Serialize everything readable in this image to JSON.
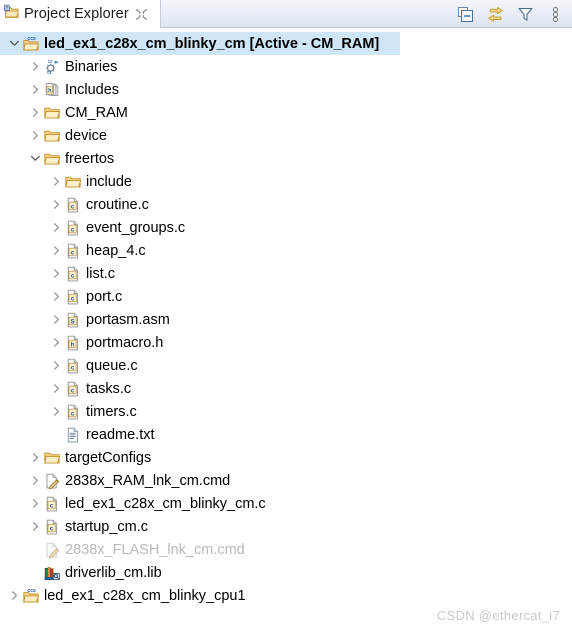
{
  "view": {
    "tab_title": "Project Explorer",
    "tab_icon": "project-explorer-icon",
    "close_icon": "tab-close-icon",
    "toolbar": [
      {
        "name": "collapse-all-button",
        "tooltip": "Collapse All"
      },
      {
        "name": "link-with-editor-button",
        "tooltip": "Link with Editor"
      },
      {
        "name": "filters-button",
        "tooltip": "Filters"
      },
      {
        "name": "view-menu-button",
        "tooltip": "View Menu"
      }
    ]
  },
  "colors": {
    "selection": "#cfe6f7",
    "folder": "#ddb978",
    "text": "#000000",
    "dimmed_text": "#b9b9b9",
    "watermark": "#c9c9c9",
    "arrow": "#8c8c8c"
  },
  "tree": [
    {
      "label": "led_ex1_c28x_cm_blinky_cm  [Active - CM_RAM]",
      "depth": 0,
      "icon": "ccs-project-icon",
      "arrow": "expanded",
      "selected": true,
      "bold": true
    },
    {
      "label": "Binaries",
      "depth": 1,
      "icon": "binaries-icon",
      "arrow": "collapsed",
      "selected": false
    },
    {
      "label": "Includes",
      "depth": 1,
      "icon": "includes-icon",
      "arrow": "collapsed",
      "selected": false
    },
    {
      "label": "CM_RAM",
      "depth": 1,
      "icon": "folder-icon",
      "arrow": "collapsed",
      "selected": false
    },
    {
      "label": "device",
      "depth": 1,
      "icon": "folder-icon",
      "arrow": "collapsed",
      "selected": false
    },
    {
      "label": "freertos",
      "depth": 1,
      "icon": "folder-icon",
      "arrow": "expanded",
      "selected": false
    },
    {
      "label": "include",
      "depth": 2,
      "icon": "folder-icon",
      "arrow": "collapsed",
      "selected": false
    },
    {
      "label": "croutine.c",
      "depth": 2,
      "icon": "c-file-icon",
      "arrow": "collapsed",
      "selected": false
    },
    {
      "label": "event_groups.c",
      "depth": 2,
      "icon": "c-file-icon",
      "arrow": "collapsed",
      "selected": false
    },
    {
      "label": "heap_4.c",
      "depth": 2,
      "icon": "c-file-icon",
      "arrow": "collapsed",
      "selected": false
    },
    {
      "label": "list.c",
      "depth": 2,
      "icon": "c-file-icon",
      "arrow": "collapsed",
      "selected": false
    },
    {
      "label": "port.c",
      "depth": 2,
      "icon": "c-file-icon",
      "arrow": "collapsed",
      "selected": false
    },
    {
      "label": "portasm.asm",
      "depth": 2,
      "icon": "asm-file-icon",
      "arrow": "collapsed",
      "selected": false
    },
    {
      "label": "portmacro.h",
      "depth": 2,
      "icon": "h-file-icon",
      "arrow": "collapsed",
      "selected": false
    },
    {
      "label": "queue.c",
      "depth": 2,
      "icon": "c-file-icon",
      "arrow": "collapsed",
      "selected": false
    },
    {
      "label": "tasks.c",
      "depth": 2,
      "icon": "c-file-icon",
      "arrow": "collapsed",
      "selected": false
    },
    {
      "label": "timers.c",
      "depth": 2,
      "icon": "c-file-icon",
      "arrow": "collapsed",
      "selected": false
    },
    {
      "label": "readme.txt",
      "depth": 2,
      "icon": "text-file-icon",
      "arrow": "none",
      "selected": false
    },
    {
      "label": "targetConfigs",
      "depth": 1,
      "icon": "folder-icon",
      "arrow": "collapsed",
      "selected": false
    },
    {
      "label": "2838x_RAM_lnk_cm.cmd",
      "depth": 1,
      "icon": "cmd-file-icon",
      "arrow": "collapsed",
      "selected": false
    },
    {
      "label": "led_ex1_c28x_cm_blinky_cm.c",
      "depth": 1,
      "icon": "c-file-icon",
      "arrow": "collapsed",
      "selected": false
    },
    {
      "label": "startup_cm.c",
      "depth": 1,
      "icon": "c-file-icon",
      "arrow": "collapsed",
      "selected": false
    },
    {
      "label": "2838x_FLASH_lnk_cm.cmd",
      "depth": 1,
      "icon": "cmd-file-excluded-icon",
      "arrow": "none",
      "selected": false,
      "dimmed": true
    },
    {
      "label": "driverlib_cm.lib",
      "depth": 1,
      "icon": "library-icon",
      "arrow": "none",
      "selected": false
    },
    {
      "label": "led_ex1_c28x_cm_blinky_cpu1",
      "depth": 0,
      "icon": "ccs-project-icon",
      "arrow": "collapsed",
      "selected": false
    }
  ],
  "watermark": "CSDN @ethercat_i7"
}
